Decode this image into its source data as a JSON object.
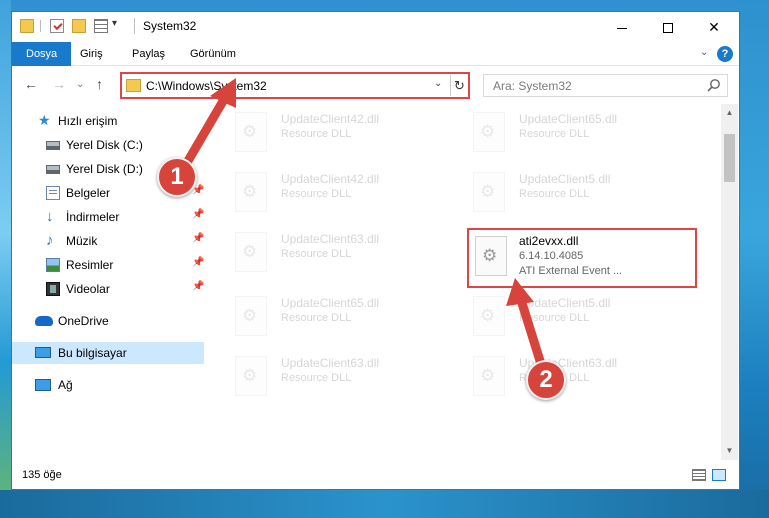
{
  "window": {
    "title": "System32"
  },
  "ribbon": {
    "tabs": [
      {
        "label": "Dosya"
      },
      {
        "label": "Giriş"
      },
      {
        "label": "Paylaş"
      },
      {
        "label": "Görünüm"
      }
    ],
    "help": "?"
  },
  "address": {
    "path": "C:\\Windows\\System32",
    "search_placeholder": "Ara: System32"
  },
  "sidebar": {
    "quick_access": "Hızlı erişim",
    "items": [
      {
        "label": "Yerel Disk (C:)",
        "icon": "hard-disk-icon"
      },
      {
        "label": "Yerel Disk (D:)",
        "icon": "hard-disk-icon"
      },
      {
        "label": "Belgeler",
        "icon": "documents-icon"
      },
      {
        "label": "İndirmeler",
        "icon": "download-icon"
      },
      {
        "label": "Müzik",
        "icon": "music-icon"
      },
      {
        "label": "Resimler",
        "icon": "pictures-icon"
      },
      {
        "label": "Videolar",
        "icon": "videos-icon"
      }
    ],
    "onedrive": "OneDrive",
    "this_pc": "Bu bilgisayar",
    "network": "Ağ"
  },
  "files": [
    {
      "name": "UpdateClient42.dll",
      "desc": "Resource DLL"
    },
    {
      "name": "UpdateClient65.dll",
      "desc": "Resource DLL"
    },
    {
      "name": "UpdateClient42.dll",
      "desc": "Resource DLL"
    },
    {
      "name": "UpdateClient5.dll",
      "desc": "Resource DLL"
    },
    {
      "name": "UpdateClient63.dll",
      "desc": "Resource DLL"
    },
    {
      "name": "ati2evxx.dll",
      "version": "6.14.10.4085",
      "desc": "ATI External Event ..."
    },
    {
      "name": "UpdateClient65.dll",
      "desc": "Resource DLL"
    },
    {
      "name": "UpdateClient5.dll",
      "desc": "Resource DLL"
    },
    {
      "name": "UpdateClient63.dll",
      "desc": "Resource DLL"
    },
    {
      "name": "UpdateClient63.dll",
      "desc": "Resource DLL"
    }
  ],
  "status": {
    "item_count": "135 öğe"
  },
  "annotations": {
    "step1": "1",
    "step2": "2"
  },
  "colors": {
    "accent": "#1979ca",
    "highlight": "#e04545",
    "badge": "#d6443b"
  }
}
